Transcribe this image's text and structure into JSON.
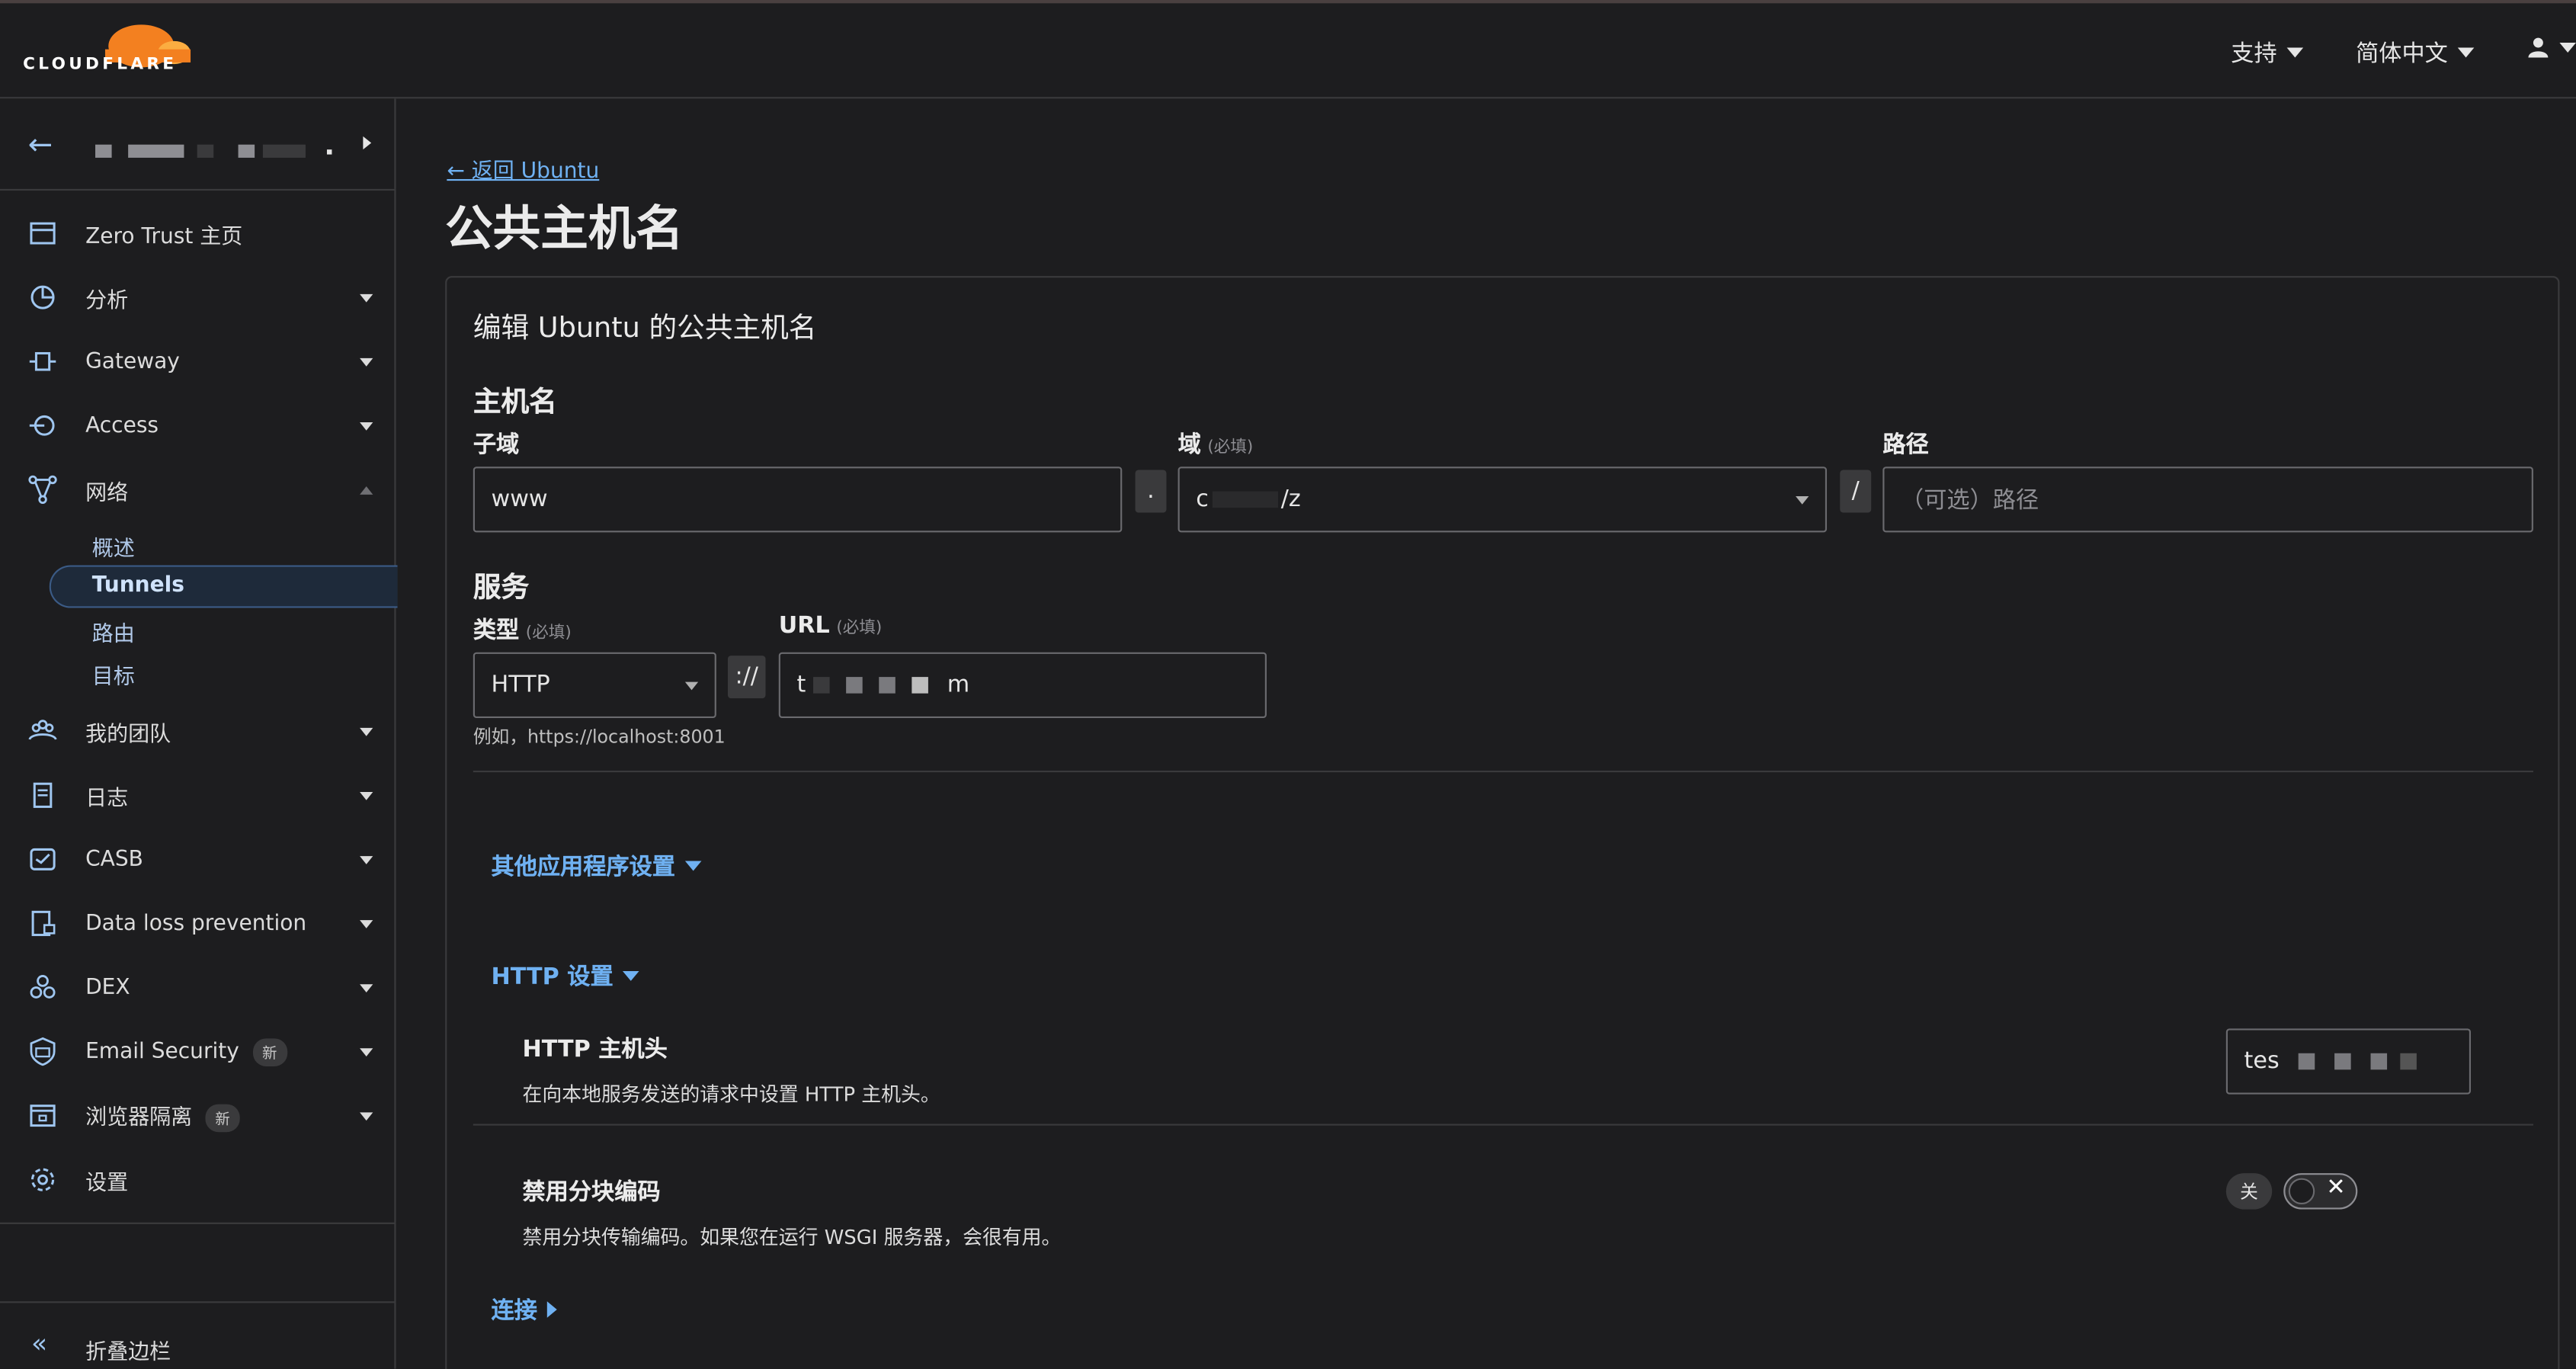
{
  "brand": {
    "logo_text": "CLOUDFLARE",
    "accent": "#f38020"
  },
  "topbar": {
    "support_label": "支持",
    "language_label": "简体中文"
  },
  "sidebar": {
    "items": [
      {
        "label": "Zero Trust 主页"
      },
      {
        "label": "分析"
      },
      {
        "label": "Gateway"
      },
      {
        "label": "Access"
      },
      {
        "label": "网络"
      },
      {
        "label": "我的团队"
      },
      {
        "label": "日志"
      },
      {
        "label": "CASB"
      },
      {
        "label": "Data loss prevention"
      },
      {
        "label": "DEX"
      },
      {
        "label": "Email Security",
        "badge": "新"
      },
      {
        "label": "浏览器隔离",
        "badge": "新"
      },
      {
        "label": "设置"
      }
    ],
    "network_sub": [
      "概述",
      "Tunnels",
      "路由",
      "目标"
    ],
    "collapse_label": "折叠边栏"
  },
  "main": {
    "back_link": "← 返回 Ubuntu",
    "title": "公共主机名",
    "card_title": "编辑 Ubuntu 的公共主机名",
    "hostname_section": "主机名",
    "subdomain_label": "子域",
    "subdomain_value": "www",
    "dot": ".",
    "domain_label": "域",
    "required": "(必填)",
    "domain_value_start": "c",
    "domain_value_end": "/z",
    "slash": "/",
    "path_label": "路径",
    "path_placeholder": "（可选）路径",
    "service_section": "服务",
    "type_label": "类型",
    "type_value": "HTTP",
    "scheme_sep": "://",
    "url_label": "URL",
    "url_value_start": "t",
    "url_value_end": "m",
    "url_hint": "例如，https://localhost:8001",
    "other_settings": "其他应用程序设置",
    "http_settings": "HTTP 设置",
    "http_host_header_title": "HTTP 主机头",
    "http_host_header_desc": "在向本地服务发送的请求中设置 HTTP 主机头。",
    "http_host_header_value_start": "tes",
    "disable_chunked_title": "禁用分块编码",
    "disable_chunked_desc": "禁用分块传输编码。如果您在运行 WSGI 服务器，会很有用。",
    "toggle_state_label": "关",
    "connection": "连接"
  }
}
